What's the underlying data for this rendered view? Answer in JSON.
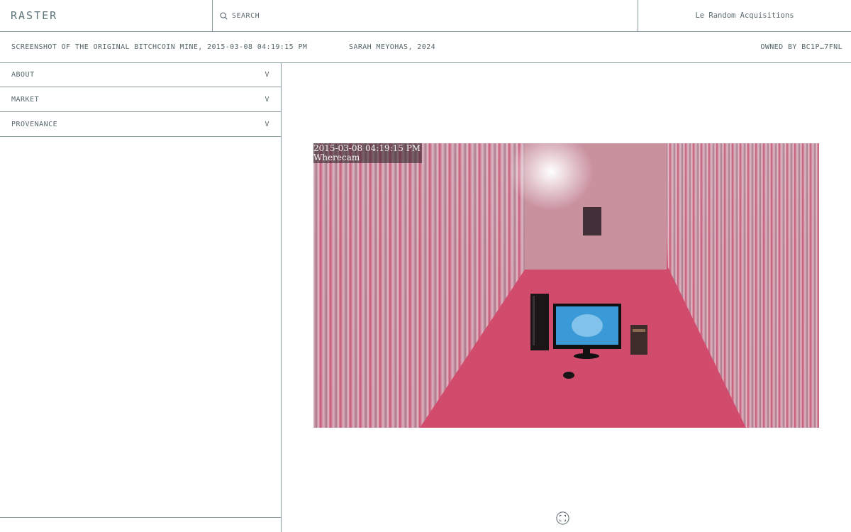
{
  "header": {
    "logo": "RASTER",
    "search_label": "SEARCH",
    "collection": "Le Random Acquisitions"
  },
  "info": {
    "title": "SCREENSHOT OF THE ORIGINAL BITCHCOIN MINE, 2015-03-08 04:19:15 PM",
    "artist": "SARAH MEYOHAS, 2024",
    "owner": "OWNED BY BC1P…7FNL"
  },
  "sidebar": {
    "items": [
      {
        "label": "ABOUT",
        "chevron": "V"
      },
      {
        "label": "MARKET",
        "chevron": "V"
      },
      {
        "label": "PROVENANCE",
        "chevron": "V"
      }
    ]
  },
  "artwork": {
    "timestamp": "2015-03-08 04:19:15 PM",
    "camera": "Wherecam"
  },
  "icons": {
    "search": "search-icon",
    "fullscreen": "fullscreen-icon"
  }
}
